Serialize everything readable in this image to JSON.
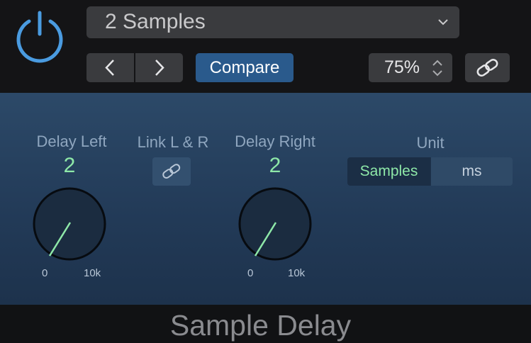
{
  "header": {
    "power_icon": "power-icon",
    "preset_name": "2 Samples",
    "prev_icon": "chevron-left-icon",
    "next_icon": "chevron-right-icon",
    "compare_label": "Compare",
    "zoom_value": "75%",
    "link_icon": "link-icon"
  },
  "controls": {
    "delay_left": {
      "label": "Delay Left",
      "value": "2",
      "min_label": "0",
      "max_label": "10k"
    },
    "link": {
      "label": "Link L & R",
      "icon": "link-icon"
    },
    "delay_right": {
      "label": "Delay Right",
      "value": "2",
      "min_label": "0",
      "max_label": "10k"
    },
    "unit": {
      "label": "Unit",
      "options": [
        "Samples",
        "ms"
      ],
      "selected": "Samples"
    }
  },
  "footer": {
    "plugin_name": "Sample Delay"
  },
  "colors": {
    "accent_green": "#8ee8a8",
    "power_blue": "#4a9be0",
    "compare_blue": "#2a5a8c"
  }
}
